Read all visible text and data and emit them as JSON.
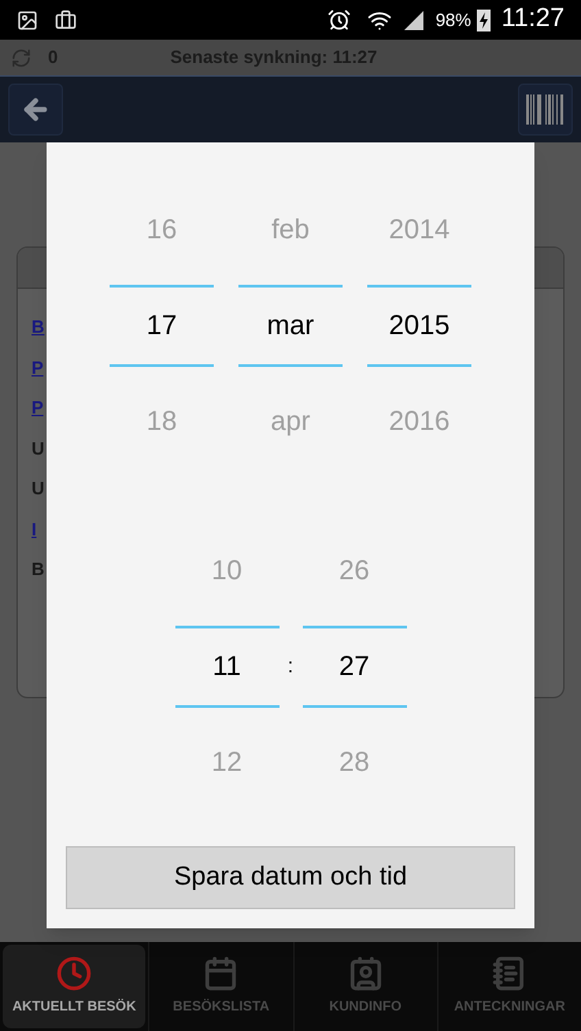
{
  "status_bar": {
    "battery": "98%",
    "time": "11:27"
  },
  "sync_bar": {
    "count": "0",
    "text": "Senaste synkning: 11:27"
  },
  "background_card": {
    "lines": [
      {
        "text": "B",
        "kind": "link"
      },
      {
        "text": "P",
        "kind": "link"
      },
      {
        "text": "P",
        "kind": "link"
      },
      {
        "text": "U",
        "kind": "plain"
      },
      {
        "text": "U",
        "kind": "plain"
      },
      {
        "text": "I",
        "kind": "link"
      },
      {
        "text": "B",
        "kind": "plain"
      }
    ]
  },
  "dialog": {
    "date_columns": [
      {
        "items": [
          {
            "label": "16",
            "selected": false
          },
          {
            "label": "17",
            "selected": true
          },
          {
            "label": "18",
            "selected": false
          }
        ]
      },
      {
        "items": [
          {
            "label": "feb",
            "selected": false
          },
          {
            "label": "mar",
            "selected": true
          },
          {
            "label": "apr",
            "selected": false
          }
        ]
      },
      {
        "items": [
          {
            "label": "2014",
            "selected": false
          },
          {
            "label": "2015",
            "selected": true
          },
          {
            "label": "2016",
            "selected": false
          }
        ]
      }
    ],
    "time_columns": [
      {
        "items": [
          {
            "label": "10",
            "selected": false
          },
          {
            "label": "11",
            "selected": true
          },
          {
            "label": "12",
            "selected": false
          }
        ]
      },
      {
        "items": [
          {
            "label": "26",
            "selected": false
          },
          {
            "label": "27",
            "selected": true
          },
          {
            "label": "28",
            "selected": false
          }
        ]
      }
    ],
    "time_separator": ":",
    "save_button": "Spara datum och tid"
  },
  "bottom_nav": [
    {
      "label": "AKTUELLT BESÖK",
      "selected": true
    },
    {
      "label": "BESÖKSLISTA",
      "selected": false
    },
    {
      "label": "KUNDINFO",
      "selected": false
    },
    {
      "label": "ANTECKNINGAR",
      "selected": false
    }
  ]
}
